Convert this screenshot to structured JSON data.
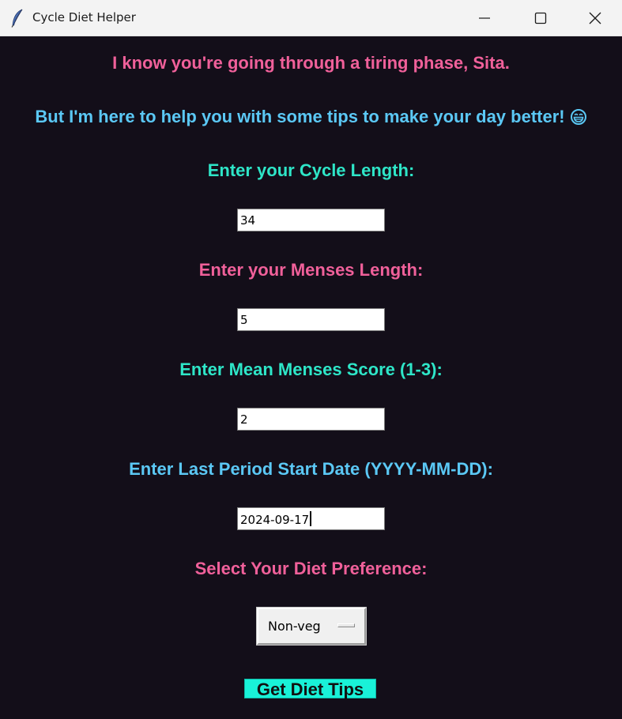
{
  "window": {
    "title": "Cycle Diet Helper",
    "controls": [
      "minimize-icon",
      "maximize-icon",
      "close-icon"
    ]
  },
  "greeting": {
    "line1": "I know you're going through a tiring phase, Sita.",
    "line2": "But I'm here to help you with some tips to make your day better!",
    "line2_icon": "grinning-face-icon"
  },
  "form": {
    "cycle_length": {
      "label": "Enter your Cycle Length:",
      "value": "34"
    },
    "menses_length": {
      "label": "Enter your Menses Length:",
      "value": "5"
    },
    "menses_score": {
      "label": "Enter Mean Menses Score (1-3):",
      "value": "2"
    },
    "last_period": {
      "label": "Enter Last Period Start Date (YYYY-MM-DD):",
      "value": "2024-09-17"
    },
    "diet": {
      "label": "Select Your Diet Preference:",
      "selected": "Non-veg"
    },
    "submit_label": "Get Diet Tips"
  },
  "colors": {
    "background": "#130e19",
    "pink": "#f0609a",
    "blue": "#5bc8f5",
    "teal": "#2ee6c8",
    "button": "#19f2d8"
  }
}
